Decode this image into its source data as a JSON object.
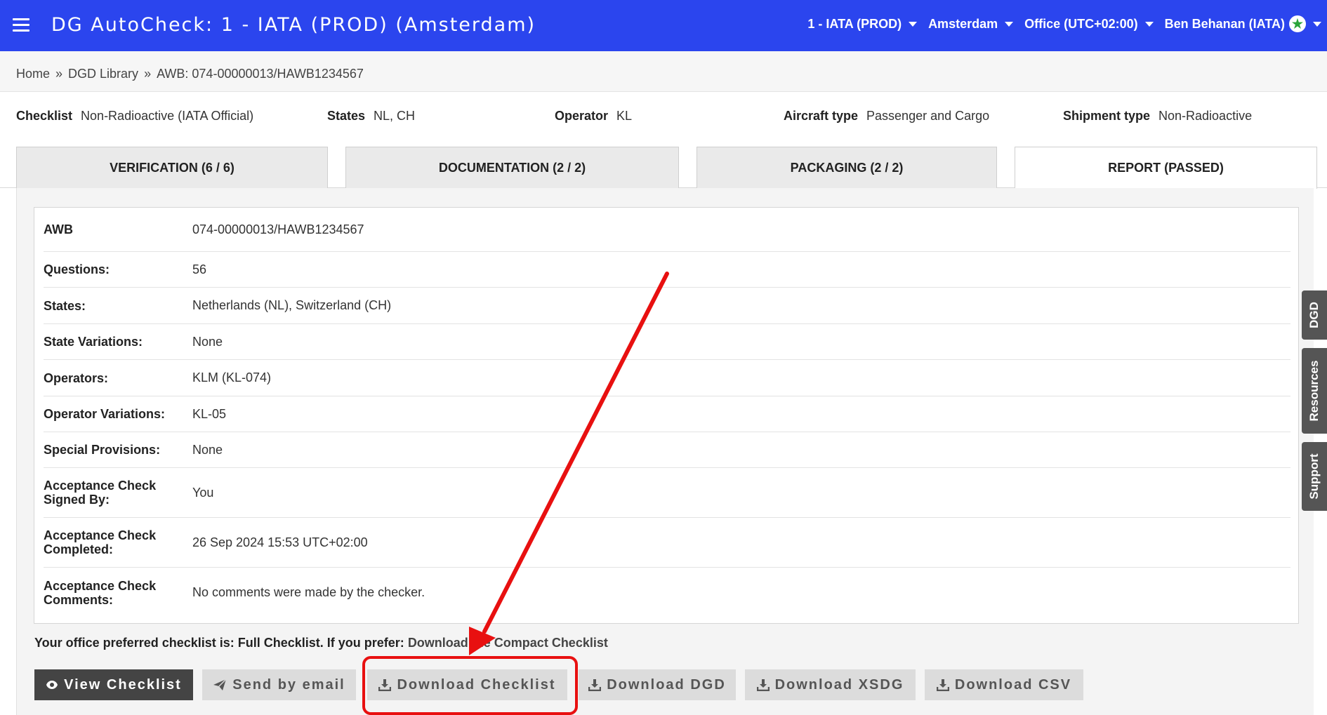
{
  "app": {
    "title": "DG AutoCheck: 1 - IATA (PROD) (Amsterdam)",
    "menus": {
      "tenant": "1 - IATA (PROD)",
      "location": "Amsterdam",
      "office": "Office (UTC+02:00)",
      "user": "Ben Behanan (IATA)"
    },
    "colors": {
      "topbar": "#2b45ee",
      "highlight": "#e81010",
      "badge_star": "#2aa43a"
    }
  },
  "breadcrumb": {
    "home": "Home",
    "library": "DGD Library",
    "current": "AWB: 074-00000013/HAWB1234567",
    "separator": "»"
  },
  "summary": {
    "checklist_label": "Checklist",
    "checklist_value": "Non-Radioactive (IATA Official)",
    "states_label": "States",
    "states_value": "NL, CH",
    "operator_label": "Operator",
    "operator_value": "KL",
    "aircraft_label": "Aircraft type",
    "aircraft_value": "Passenger and Cargo",
    "shipment_label": "Shipment type",
    "shipment_value": "Non-Radioactive"
  },
  "tabs": [
    {
      "label": "VERIFICATION (6 / 6)"
    },
    {
      "label": "DOCUMENTATION (2 / 2)"
    },
    {
      "label": "PACKAGING (2 / 2)"
    },
    {
      "label": "REPORT (PASSED)"
    }
  ],
  "details": [
    {
      "label": "AWB",
      "value": "074-00000013/HAWB1234567"
    },
    {
      "label": "Questions:",
      "value": "56"
    },
    {
      "label": "States:",
      "value": "Netherlands (NL), Switzerland (CH)"
    },
    {
      "label": "State Variations:",
      "value": "None"
    },
    {
      "label": "Operators:",
      "value": "KLM (KL-074)"
    },
    {
      "label": "Operator Variations:",
      "value": "KL-05"
    },
    {
      "label": "Special Provisions:",
      "value": "None"
    },
    {
      "label": "Acceptance Check Signed By:",
      "value": "You"
    },
    {
      "label": "Acceptance Check Completed:",
      "value": "26 Sep 2024 15:53 UTC+02:00"
    },
    {
      "label": "Acceptance Check Comments:",
      "value": "No comments were made by the checker."
    }
  ],
  "preference": {
    "text": "Your office preferred checklist is: Full Checklist. If you prefer: ",
    "link": "Download the Compact Checklist"
  },
  "buttons": {
    "view_checklist": "View Checklist",
    "send_email": "Send by email",
    "download_checklist": "Download Checklist",
    "download_dgd": "Download DGD",
    "download_xsdg": "Download XSDG",
    "download_csv": "Download CSV"
  },
  "side_tabs": {
    "dgd": "DGD",
    "resources": "Resources",
    "support": "Support"
  }
}
